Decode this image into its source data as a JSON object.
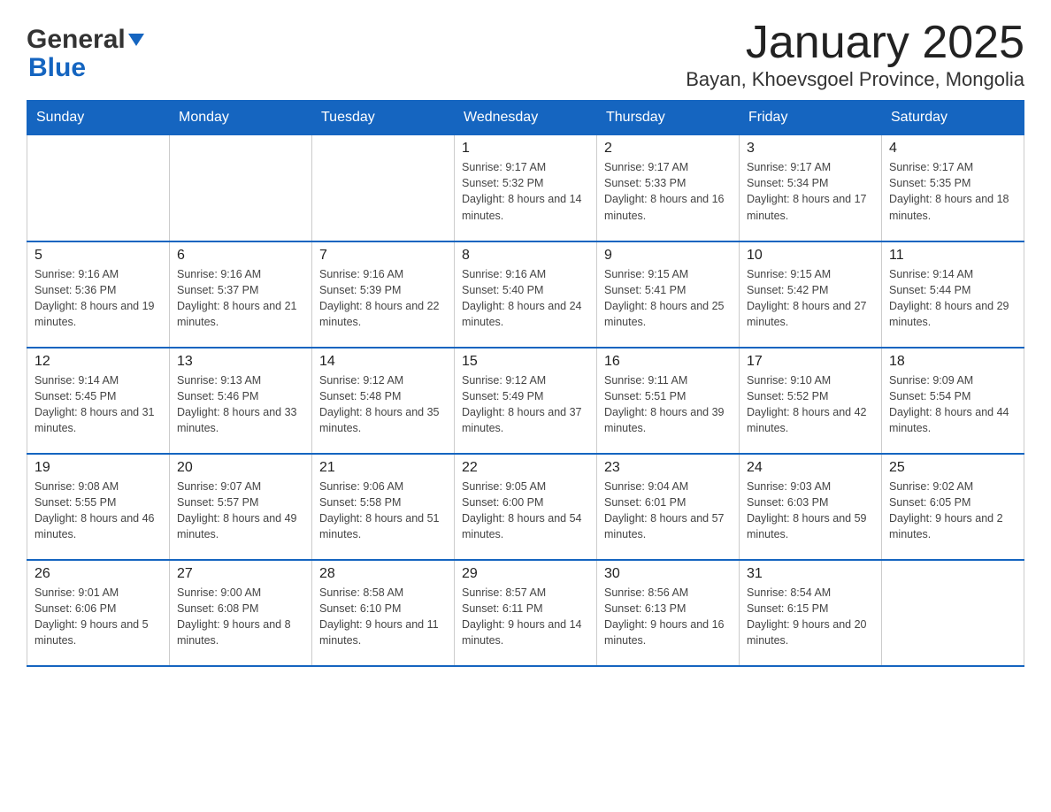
{
  "header": {
    "month": "January 2025",
    "location": "Bayan, Khoevsgoel Province, Mongolia",
    "logo_general": "General",
    "logo_blue": "Blue"
  },
  "weekdays": [
    "Sunday",
    "Monday",
    "Tuesday",
    "Wednesday",
    "Thursday",
    "Friday",
    "Saturday"
  ],
  "weeks": [
    [
      null,
      null,
      null,
      {
        "day": 1,
        "sunrise": "9:17 AM",
        "sunset": "5:32 PM",
        "daylight": "8 hours and 14 minutes."
      },
      {
        "day": 2,
        "sunrise": "9:17 AM",
        "sunset": "5:33 PM",
        "daylight": "8 hours and 16 minutes."
      },
      {
        "day": 3,
        "sunrise": "9:17 AM",
        "sunset": "5:34 PM",
        "daylight": "8 hours and 17 minutes."
      },
      {
        "day": 4,
        "sunrise": "9:17 AM",
        "sunset": "5:35 PM",
        "daylight": "8 hours and 18 minutes."
      }
    ],
    [
      {
        "day": 5,
        "sunrise": "9:16 AM",
        "sunset": "5:36 PM",
        "daylight": "8 hours and 19 minutes."
      },
      {
        "day": 6,
        "sunrise": "9:16 AM",
        "sunset": "5:37 PM",
        "daylight": "8 hours and 21 minutes."
      },
      {
        "day": 7,
        "sunrise": "9:16 AM",
        "sunset": "5:39 PM",
        "daylight": "8 hours and 22 minutes."
      },
      {
        "day": 8,
        "sunrise": "9:16 AM",
        "sunset": "5:40 PM",
        "daylight": "8 hours and 24 minutes."
      },
      {
        "day": 9,
        "sunrise": "9:15 AM",
        "sunset": "5:41 PM",
        "daylight": "8 hours and 25 minutes."
      },
      {
        "day": 10,
        "sunrise": "9:15 AM",
        "sunset": "5:42 PM",
        "daylight": "8 hours and 27 minutes."
      },
      {
        "day": 11,
        "sunrise": "9:14 AM",
        "sunset": "5:44 PM",
        "daylight": "8 hours and 29 minutes."
      }
    ],
    [
      {
        "day": 12,
        "sunrise": "9:14 AM",
        "sunset": "5:45 PM",
        "daylight": "8 hours and 31 minutes."
      },
      {
        "day": 13,
        "sunrise": "9:13 AM",
        "sunset": "5:46 PM",
        "daylight": "8 hours and 33 minutes."
      },
      {
        "day": 14,
        "sunrise": "9:12 AM",
        "sunset": "5:48 PM",
        "daylight": "8 hours and 35 minutes."
      },
      {
        "day": 15,
        "sunrise": "9:12 AM",
        "sunset": "5:49 PM",
        "daylight": "8 hours and 37 minutes."
      },
      {
        "day": 16,
        "sunrise": "9:11 AM",
        "sunset": "5:51 PM",
        "daylight": "8 hours and 39 minutes."
      },
      {
        "day": 17,
        "sunrise": "9:10 AM",
        "sunset": "5:52 PM",
        "daylight": "8 hours and 42 minutes."
      },
      {
        "day": 18,
        "sunrise": "9:09 AM",
        "sunset": "5:54 PM",
        "daylight": "8 hours and 44 minutes."
      }
    ],
    [
      {
        "day": 19,
        "sunrise": "9:08 AM",
        "sunset": "5:55 PM",
        "daylight": "8 hours and 46 minutes."
      },
      {
        "day": 20,
        "sunrise": "9:07 AM",
        "sunset": "5:57 PM",
        "daylight": "8 hours and 49 minutes."
      },
      {
        "day": 21,
        "sunrise": "9:06 AM",
        "sunset": "5:58 PM",
        "daylight": "8 hours and 51 minutes."
      },
      {
        "day": 22,
        "sunrise": "9:05 AM",
        "sunset": "6:00 PM",
        "daylight": "8 hours and 54 minutes."
      },
      {
        "day": 23,
        "sunrise": "9:04 AM",
        "sunset": "6:01 PM",
        "daylight": "8 hours and 57 minutes."
      },
      {
        "day": 24,
        "sunrise": "9:03 AM",
        "sunset": "6:03 PM",
        "daylight": "8 hours and 59 minutes."
      },
      {
        "day": 25,
        "sunrise": "9:02 AM",
        "sunset": "6:05 PM",
        "daylight": "9 hours and 2 minutes."
      }
    ],
    [
      {
        "day": 26,
        "sunrise": "9:01 AM",
        "sunset": "6:06 PM",
        "daylight": "9 hours and 5 minutes."
      },
      {
        "day": 27,
        "sunrise": "9:00 AM",
        "sunset": "6:08 PM",
        "daylight": "9 hours and 8 minutes."
      },
      {
        "day": 28,
        "sunrise": "8:58 AM",
        "sunset": "6:10 PM",
        "daylight": "9 hours and 11 minutes."
      },
      {
        "day": 29,
        "sunrise": "8:57 AM",
        "sunset": "6:11 PM",
        "daylight": "9 hours and 14 minutes."
      },
      {
        "day": 30,
        "sunrise": "8:56 AM",
        "sunset": "6:13 PM",
        "daylight": "9 hours and 16 minutes."
      },
      {
        "day": 31,
        "sunrise": "8:54 AM",
        "sunset": "6:15 PM",
        "daylight": "9 hours and 20 minutes."
      },
      null
    ]
  ],
  "labels": {
    "sunrise_prefix": "Sunrise: ",
    "sunset_prefix": "Sunset: ",
    "daylight_prefix": "Daylight: "
  }
}
